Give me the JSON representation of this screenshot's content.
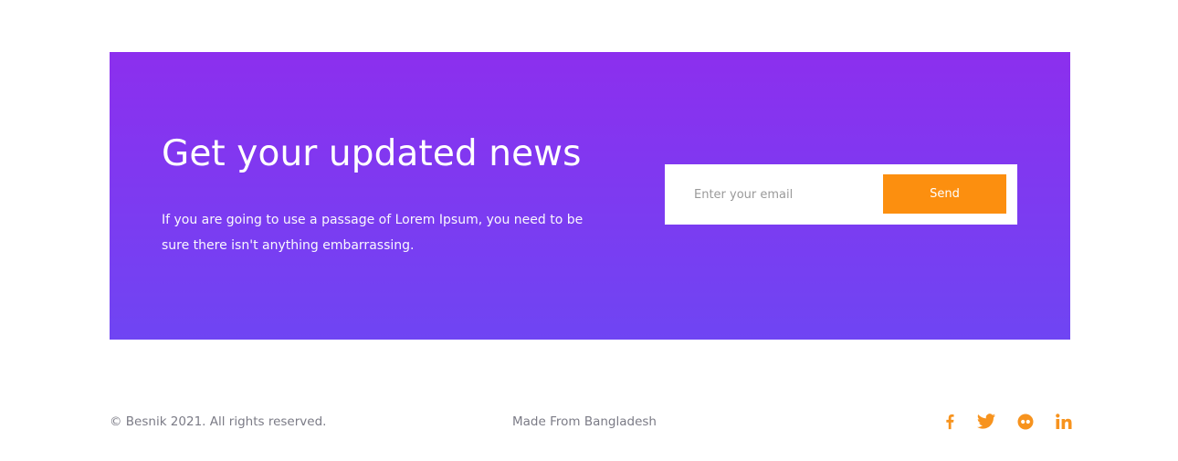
{
  "newsletter": {
    "headline": "Get your updated news",
    "subtext": "If you are going to use a passage of Lorem Ipsum, you need to be sure there isn't anything embarrassing.",
    "email_placeholder": "Enter your email",
    "send_label": "Send",
    "gradient_top": "#8c2fee",
    "gradient_bottom": "#6f45f3",
    "button_color": "#fc8f0f"
  },
  "footer": {
    "copyright": "© Besnik 2021. All rights reserved.",
    "made_from": "Made From Bangladesh",
    "social_icons": [
      "facebook-icon",
      "twitter-icon",
      "flickr-icon",
      "linkedin-icon"
    ],
    "icon_color": "#f7931e"
  }
}
